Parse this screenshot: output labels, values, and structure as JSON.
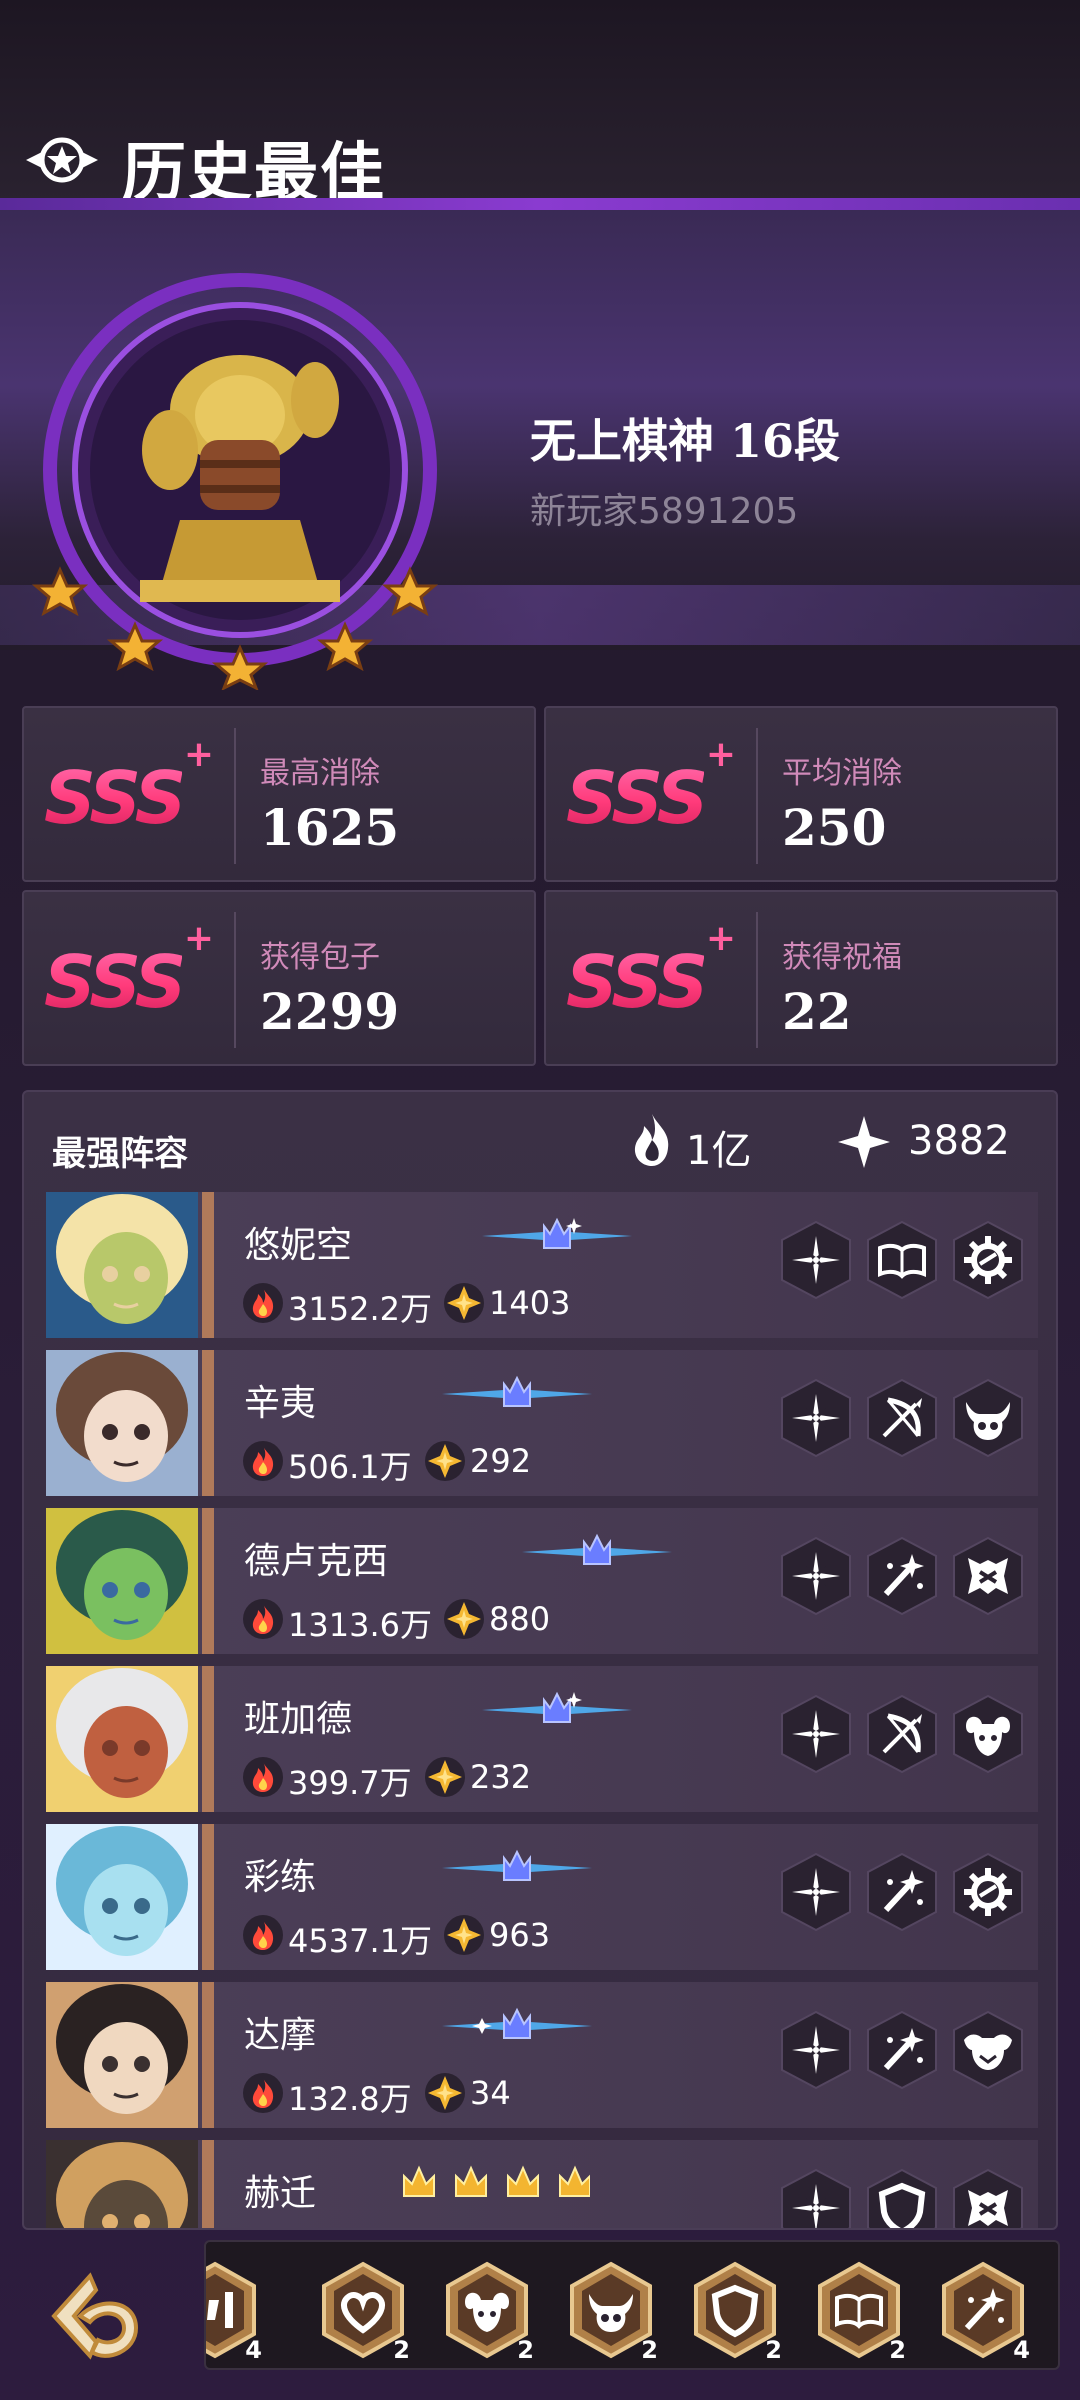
{
  "header": {
    "title": "历史最佳",
    "icon": "star-wings-icon"
  },
  "profile": {
    "rank_title": "无上棋神  16段",
    "player_name": "新玩家5891205"
  },
  "stats": [
    {
      "grade": "SSS",
      "label": "最高消除",
      "value": "1625"
    },
    {
      "grade": "SSS",
      "label": "平均消除",
      "value": "250"
    },
    {
      "grade": "SSS",
      "label": "获得包子",
      "value": "2299"
    },
    {
      "grade": "SSS",
      "label": "获得祝福",
      "value": "22"
    }
  ],
  "lineup": {
    "title": "最强阵容",
    "total_power": "1亿",
    "total_stars": "3882",
    "heroes": [
      {
        "name": "悠妮空",
        "power": "3152.2万",
        "stars": "1403",
        "badges": [
          "compass-star-icon",
          "book-icon",
          "gear-icon"
        ]
      },
      {
        "name": "辛夷",
        "power": "506.1万",
        "stars": "292",
        "badges": [
          "compass-star-icon",
          "bow-icon",
          "skull-horn-icon"
        ]
      },
      {
        "name": "德卢克西",
        "power": "1313.6万",
        "stars": "880",
        "badges": [
          "compass-star-icon",
          "wand-icon",
          "armor-icon"
        ]
      },
      {
        "name": "班加德",
        "power": "399.7万",
        "stars": "232",
        "badges": [
          "compass-star-icon",
          "bow-icon",
          "ram-icon"
        ]
      },
      {
        "name": "彩练",
        "power": "4537.1万",
        "stars": "963",
        "badges": [
          "compass-star-icon",
          "wand-icon",
          "gear-icon"
        ]
      },
      {
        "name": "达摩",
        "power": "132.8万",
        "stars": "34",
        "badges": [
          "compass-star-icon",
          "wand-icon",
          "beast-icon"
        ]
      },
      {
        "name": "赫迁",
        "power": "",
        "stars": "",
        "badges": [
          "compass-star-icon",
          "shield-icon",
          "armor-icon"
        ]
      }
    ]
  },
  "traits": [
    {
      "icon": "partial-icon",
      "count": "4"
    },
    {
      "icon": "heart-icon",
      "count": "2"
    },
    {
      "icon": "ram-icon",
      "count": "2"
    },
    {
      "icon": "skull-horn-icon",
      "count": "2"
    },
    {
      "icon": "shield-icon",
      "count": "2"
    },
    {
      "icon": "book-icon",
      "count": "2"
    },
    {
      "icon": "wand-icon",
      "count": "4"
    }
  ]
}
